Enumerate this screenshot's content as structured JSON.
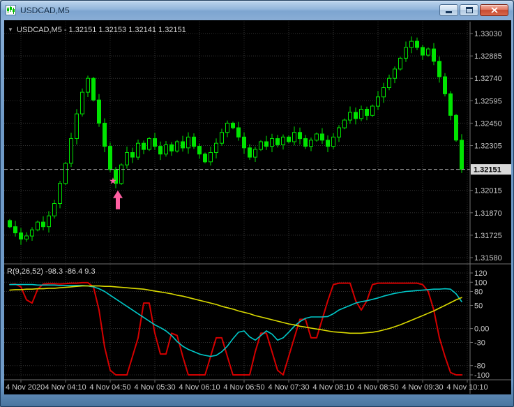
{
  "window": {
    "title": "USDCAD,M5",
    "controls": {
      "minimize": "minimize-icon",
      "restore": "restore-icon",
      "close": "close-icon"
    }
  },
  "chart": {
    "header": "USDCAD,M5 - 1.32151 1.32153 1.32141 1.32151",
    "dropdown_glyph": "▼",
    "current_price": "1.32151",
    "price_axis": [
      "1.33030",
      "1.32885",
      "1.32740",
      "1.32595",
      "1.32450",
      "1.32305",
      "1.32015",
      "1.31870",
      "1.31725",
      "1.31580"
    ],
    "time_axis": [
      "4 Nov 2020",
      "4 Nov 04:10",
      "4 Nov 04:50",
      "4 Nov 05:30",
      "4 Nov 06:10",
      "4 Nov 06:50",
      "4 Nov 07:30",
      "4 Nov 08:10",
      "4 Nov 08:50",
      "4 Nov 09:30",
      "4 Nov 10:10"
    ]
  },
  "indicator": {
    "header": "R(9,26,52) -98.3 -86.4 9.3",
    "axis": [
      "120",
      "100",
      "80",
      "50",
      "0.00",
      "-30",
      "-80",
      "-100"
    ]
  },
  "chart_data": {
    "type": "candlestick",
    "symbol": "USDCAD",
    "timeframe": "M5",
    "ohlc": {
      "open": "1.32151",
      "high": "1.32153",
      "low": "1.32141",
      "close": "1.32151"
    },
    "price_range": [
      1.3158,
      1.3303
    ],
    "closes": [
      1.3178,
      1.3174,
      1.317,
      1.3172,
      1.3176,
      1.3181,
      1.3178,
      1.3185,
      1.3193,
      1.3206,
      1.3219,
      1.3235,
      1.3251,
      1.3265,
      1.3274,
      1.326,
      1.3245,
      1.323,
      1.3215,
      1.3206,
      1.3218,
      1.3226,
      1.3223,
      1.3232,
      1.3228,
      1.3235,
      1.323,
      1.3225,
      1.3231,
      1.3227,
      1.3233,
      1.3229,
      1.3236,
      1.323,
      1.3225,
      1.322,
      1.3226,
      1.3232,
      1.3239,
      1.3245,
      1.3242,
      1.3236,
      1.3229,
      1.3223,
      1.3228,
      1.3233,
      1.323,
      1.3235,
      1.3231,
      1.3236,
      1.3233,
      1.3239,
      1.3235,
      1.323,
      1.3234,
      1.3238,
      1.3234,
      1.323,
      1.3236,
      1.3242,
      1.3247,
      1.3252,
      1.3248,
      1.3254,
      1.325,
      1.3256,
      1.3262,
      1.3268,
      1.3274,
      1.328,
      1.3287,
      1.3294,
      1.3298,
      1.3294,
      1.3289,
      1.3293,
      1.3285,
      1.3275,
      1.3264,
      1.325,
      1.3234,
      1.32151
    ],
    "oscillator": {
      "name": "R(9,26,52)",
      "values": [
        "-98.3",
        "-86.4",
        "9.3"
      ],
      "levels": [
        120,
        100,
        80,
        50,
        0,
        -30,
        -80,
        -100
      ],
      "range": [
        -120,
        130
      ],
      "series": [
        {
          "name": "oscillator-line-red",
          "color": "#D40000",
          "width": 2,
          "values": [
            95,
            96,
            90,
            62,
            55,
            85,
            96,
            97,
            97,
            96,
            97,
            98,
            98,
            99,
            99,
            90,
            40,
            -40,
            -90,
            -100,
            -100,
            -100,
            -60,
            -20,
            55,
            55,
            -10,
            -55,
            -55,
            -10,
            -15,
            -60,
            -100,
            -100,
            -100,
            -100,
            -60,
            -20,
            -20,
            -60,
            -100,
            -100,
            -100,
            -100,
            -50,
            -10,
            -10,
            -50,
            -90,
            -100,
            -60,
            -20,
            20,
            20,
            -20,
            -20,
            20,
            60,
            95,
            98,
            98,
            98,
            60,
            40,
            60,
            95,
            98,
            98,
            98,
            98,
            98,
            98,
            98,
            98,
            95,
            80,
            40,
            -20,
            -60,
            -95,
            -100,
            -100
          ]
        },
        {
          "name": "oscillator-line-cyan",
          "color": "#00C8C8",
          "width": 1.6,
          "values": [
            95,
            95,
            95,
            95,
            95,
            94,
            94,
            94,
            94,
            93,
            93,
            93,
            93,
            93,
            92,
            90,
            86,
            80,
            72,
            64,
            56,
            48,
            40,
            32,
            24,
            16,
            8,
            2,
            -5,
            -15,
            -28,
            -38,
            -45,
            -50,
            -55,
            -58,
            -60,
            -58,
            -50,
            -38,
            -22,
            -8,
            -5,
            -18,
            -25,
            -15,
            -5,
            -12,
            -25,
            -20,
            -8,
            5,
            15,
            22,
            25,
            25,
            25,
            26,
            32,
            40,
            45,
            50,
            55,
            58,
            60,
            63,
            66,
            70,
            73,
            76,
            78,
            80,
            81,
            82,
            83,
            84,
            85,
            85,
            86,
            85,
            75,
            58
          ]
        },
        {
          "name": "oscillator-line-yellow",
          "color": "#DADA00",
          "width": 1.6,
          "values": [
            83,
            84,
            84,
            85,
            85,
            86,
            86,
            87,
            87,
            88,
            89,
            90,
            91,
            92,
            92,
            92,
            92,
            91,
            91,
            90,
            89,
            88,
            87,
            86,
            85,
            83,
            81,
            79,
            77,
            75,
            72,
            70,
            67,
            64,
            61,
            58,
            55,
            52,
            48,
            45,
            42,
            38,
            35,
            32,
            28,
            25,
            22,
            19,
            16,
            13,
            10,
            8,
            5,
            3,
            1,
            -1,
            -3,
            -5,
            -7,
            -8,
            -9,
            -10,
            -10,
            -10,
            -9,
            -8,
            -6,
            -3,
            0,
            4,
            8,
            13,
            18,
            23,
            28,
            33,
            38,
            44,
            50,
            56,
            62,
            67
          ]
        }
      ]
    },
    "annotations": [
      {
        "type": "star",
        "glyph": "★",
        "candle_index": 19,
        "price": 1.32075,
        "color": "#FF5FA2"
      },
      {
        "type": "arrow-up",
        "candle_index": 19,
        "price": 1.32015,
        "color": "#FF5FA2"
      }
    ],
    "colors": {
      "candle": "#00E400",
      "background": "#000000",
      "grid": "#343434",
      "bid_line": "#ABABAB"
    }
  }
}
